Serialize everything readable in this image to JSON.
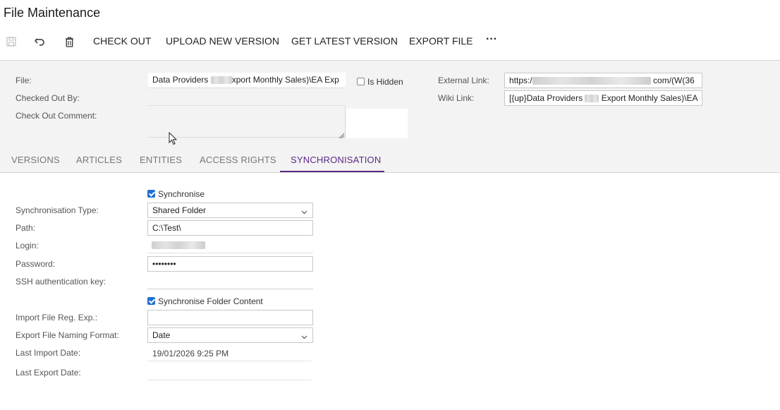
{
  "page": {
    "title": "File Maintenance"
  },
  "toolbar": {
    "save_icon": "save-icon",
    "undo_icon": "undo-icon",
    "delete_icon": "trash-icon",
    "check_out": "CHECK OUT",
    "upload_new_version": "UPLOAD NEW VERSION",
    "get_latest_version": "GET LATEST VERSION",
    "export_file": "EXPORT FILE",
    "more": "···"
  },
  "summary": {
    "file_label": "File:",
    "file_value_a": "Data Providers",
    "file_value_b": "xport Monthly Sales)\\EA Exp",
    "is_hidden_label": "Is Hidden",
    "is_hidden_checked": false,
    "external_link_label": "External Link:",
    "external_link_a": "https:/",
    "external_link_b": "com/(W(36",
    "checked_out_by_label": "Checked Out By:",
    "checked_out_by_value": "",
    "wiki_link_label": "Wiki Link:",
    "wiki_link_a": "[{up}Data Providers",
    "wiki_link_b": "Export Monthly Sales)\\EA",
    "check_out_comment_label": "Check Out Comment:",
    "check_out_comment_value": ""
  },
  "tabs": [
    {
      "label": "VERSIONS",
      "active": false
    },
    {
      "label": "ARTICLES",
      "active": false
    },
    {
      "label": "ENTITIES",
      "active": false
    },
    {
      "label": "ACCESS RIGHTS",
      "active": false
    },
    {
      "label": "SYNCHRONISATION",
      "active": true
    }
  ],
  "sync": {
    "synchronise_label": "Synchronise",
    "synchronise_checked": true,
    "type_label": "Synchronisation Type:",
    "type_value": "Shared Folder",
    "path_label": "Path:",
    "path_value": "C:\\Test\\",
    "login_label": "Login:",
    "password_label": "Password:",
    "password_value": "••••••••",
    "ssh_label": "SSH authentication key:",
    "ssh_value": "",
    "folder_content_label": "Synchronise Folder Content",
    "folder_content_checked": true,
    "import_regexp_label": "Import File Reg. Exp.:",
    "import_regexp_value": "",
    "export_format_label": "Export File Naming Format:",
    "export_format_value": "Date",
    "last_import_label": "Last Import Date:",
    "last_import_value": "19/01/2026 9:25 PM",
    "last_export_label": "Last Export Date:",
    "last_export_value": ""
  },
  "colors": {
    "accent": "#5b2a86",
    "checkbox": "#1f6fd1",
    "panel_bg": "#f3f3f3"
  }
}
